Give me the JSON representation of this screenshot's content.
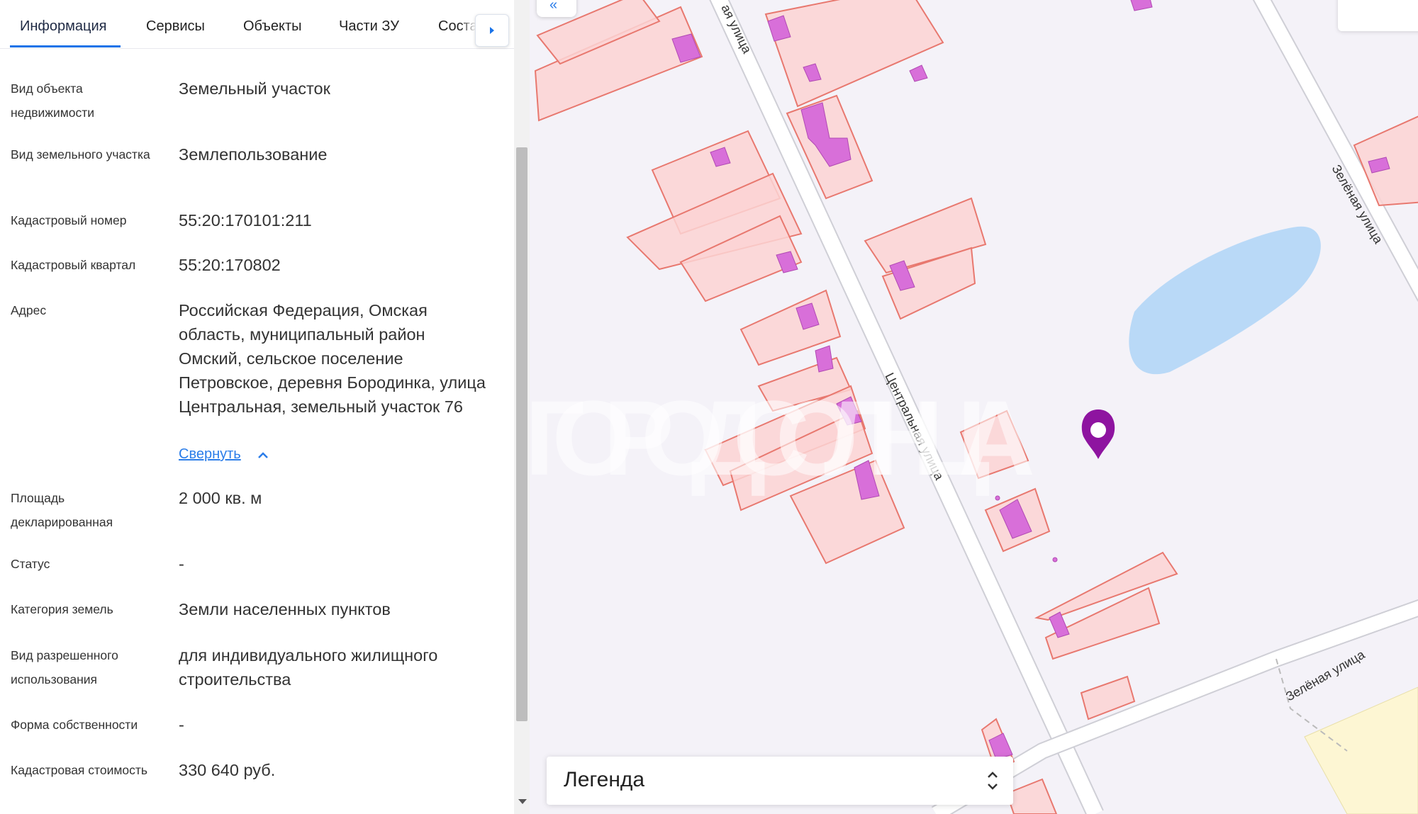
{
  "tabs": [
    {
      "label": "Информация",
      "active": true
    },
    {
      "label": "Сервисы"
    },
    {
      "label": "Объекты"
    },
    {
      "label": "Части ЗУ"
    },
    {
      "label": "Соста"
    }
  ],
  "fields": [
    {
      "label": "Вид объекта недвижимости",
      "value": "Земельный участок"
    },
    {
      "label": "Вид земельного участка",
      "value": "Землепользование"
    },
    {
      "label": "Кадастровый номер",
      "value": "55:20:170101:211"
    },
    {
      "label": "Кадастровый квартал",
      "value": "55:20:170802"
    },
    {
      "label": "Адрес",
      "value": "Российская Федерация, Омская область, муниципальный район Омский, сельское поселение Петровское, деревня Бородинка, улица Центральная, земельный участок 76"
    },
    {
      "label": "Площадь декларированная",
      "value": "2 000 кв. м"
    },
    {
      "label": "Статус",
      "value": "-"
    },
    {
      "label": "Категория земель",
      "value": "Земли населенных пунктов"
    },
    {
      "label": "Вид разрешенного использования",
      "value": "для индивидуального жилищного строительства"
    },
    {
      "label": "Форма собственности",
      "value": "-"
    },
    {
      "label": "Кадастровая стоимость",
      "value": "330 640 руб."
    }
  ],
  "address_collapse_label": "Свернуть",
  "map": {
    "streets": [
      "Центральная улица",
      "Зелёная улица",
      "Зелёная улица",
      "ая улица"
    ],
    "watermark": "ГОРОД СОЛНЦА",
    "colors": {
      "parcel_fill": "#fbd3d3",
      "parcel_stroke": "#e8786f",
      "building_fill": "#d86fd9",
      "road": "#ffffff",
      "road_casing": "#cfcfd6",
      "water": "#b9d9f7",
      "marker": "#8e14a0"
    }
  },
  "legend": {
    "title": "Легенда"
  }
}
